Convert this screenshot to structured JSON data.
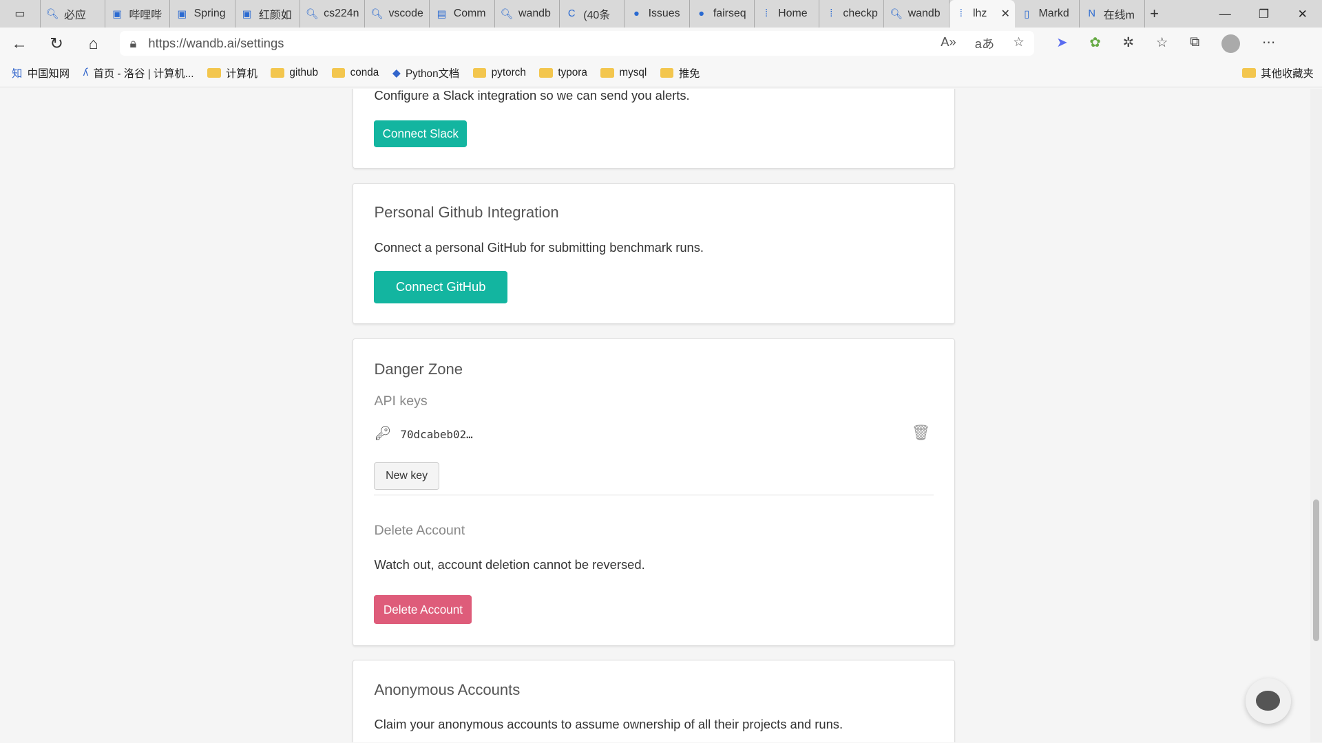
{
  "browser": {
    "tabs": [
      {
        "label": "必应",
        "icon": "search-icon"
      },
      {
        "label": "哔哩哔",
        "icon": "bilibili-icon"
      },
      {
        "label": "Spring",
        "icon": "bilibili-icon"
      },
      {
        "label": "红颜如",
        "icon": "bilibili-icon"
      },
      {
        "label": "cs224n",
        "icon": "search-icon"
      },
      {
        "label": "vscode",
        "icon": "search-icon"
      },
      {
        "label": "Comm",
        "icon": "document-icon"
      },
      {
        "label": "wandb",
        "icon": "search-icon"
      },
      {
        "label": "(40条",
        "icon": "csdn-icon"
      },
      {
        "label": "Issues",
        "icon": "github-icon"
      },
      {
        "label": "fairseq",
        "icon": "github-icon"
      },
      {
        "label": "Home",
        "icon": "wandb-icon"
      },
      {
        "label": "checkp",
        "icon": "wandb-icon"
      },
      {
        "label": "wandb",
        "icon": "search-icon"
      },
      {
        "label": "lhz",
        "icon": "wandb-icon",
        "active": true
      },
      {
        "label": "Markd",
        "icon": "page-icon"
      },
      {
        "label": "在线m",
        "icon": "markdown-icon"
      }
    ],
    "url": "https://wandb.ai/settings",
    "bookmarks": [
      {
        "label": "中国知网",
        "icon": "cnki-icon"
      },
      {
        "label": "首页 - 洛谷 | 计算机...",
        "icon": "luogu-icon"
      },
      {
        "label": "计算机",
        "icon": "folder-icon"
      },
      {
        "label": "github",
        "icon": "folder-icon"
      },
      {
        "label": "conda",
        "icon": "folder-icon"
      },
      {
        "label": "Python文档",
        "icon": "python-icon"
      },
      {
        "label": "pytorch",
        "icon": "folder-icon"
      },
      {
        "label": "typora",
        "icon": "folder-icon"
      },
      {
        "label": "mysql",
        "icon": "folder-icon"
      },
      {
        "label": "推免",
        "icon": "folder-icon"
      }
    ],
    "other_bookmarks": "其他收藏夹"
  },
  "slack": {
    "description": "Configure a Slack integration so we can send you alerts.",
    "button": "Connect Slack"
  },
  "github": {
    "title": "Personal Github Integration",
    "description": "Connect a personal GitHub for submitting benchmark runs.",
    "button": "Connect GitHub"
  },
  "danger": {
    "title": "Danger Zone",
    "api_title": "API keys",
    "api_key": "70dcabeb02…",
    "new_key": "New key",
    "delete_title": "Delete Account",
    "delete_desc": "Watch out, account deletion cannot be reversed.",
    "delete_button": "Delete Account"
  },
  "anon": {
    "title": "Anonymous Accounts",
    "description": "Claim your anonymous accounts to assume ownership of all their projects and runs."
  },
  "colors": {
    "teal": "#13b5a0",
    "danger": "#de5c7a"
  }
}
